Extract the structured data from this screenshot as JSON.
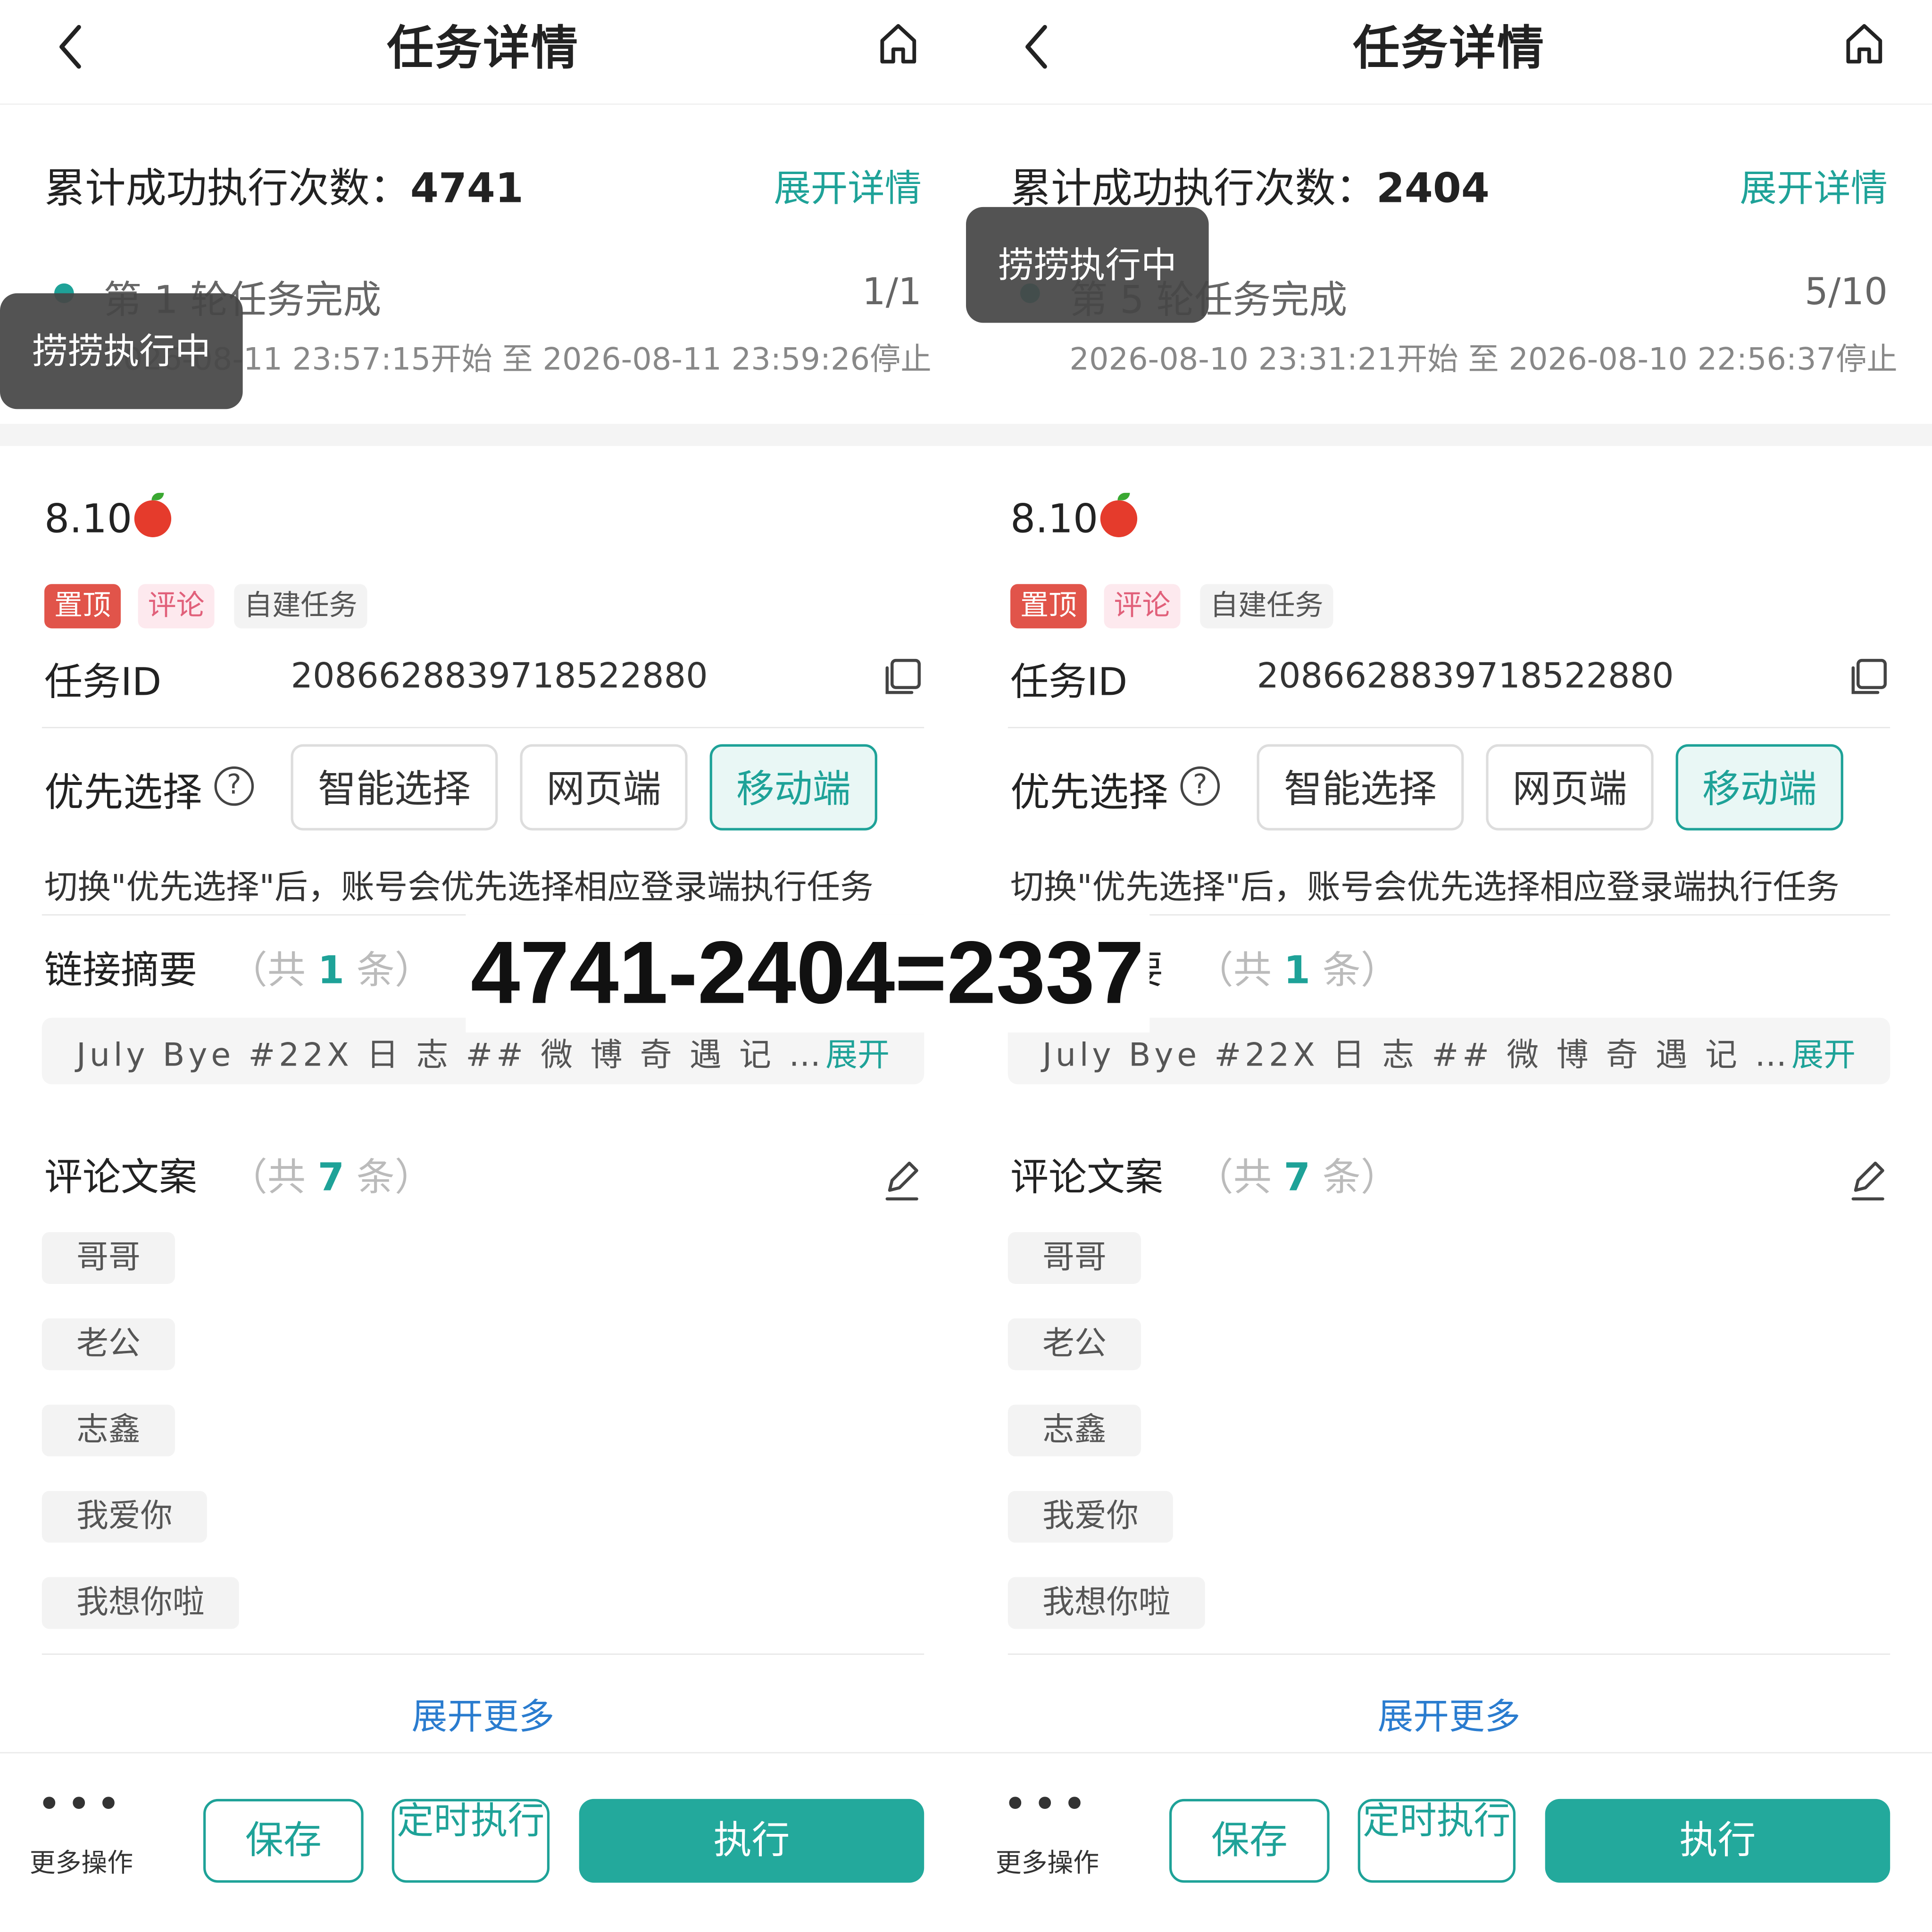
{
  "header": {
    "title": "任务详情"
  },
  "panels": [
    {
      "count_label": "累计成功执行次数：",
      "count_value": "4741",
      "expand_detail": "展开详情",
      "round_text": "第 1 轮任务完成",
      "progress": "1/1",
      "times": "2026-08-11 23:57:15开始 至 2026-08-11 23:59:26停止",
      "toast": "捞捞执行中"
    },
    {
      "count_label": "累计成功执行次数：",
      "count_value": "2404",
      "expand_detail": "展开详情",
      "round_text": "第 5 轮任务完成",
      "progress": "5/10",
      "times": "2026-08-10 23:31:21开始 至 2026-08-10 22:56:37停止",
      "toast": "捞捞执行中"
    }
  ],
  "task": {
    "name": "8.10",
    "name_icon": "apple-emoji",
    "tags": {
      "top": "置顶",
      "comment": "评论",
      "self": "自建任务"
    },
    "id_label": "任务ID",
    "id_value": "2086628839718522880",
    "priority_label": "优先选择",
    "options": [
      "智能选择",
      "网页端",
      "移动端"
    ],
    "selected_option": "移动端",
    "hint": "切换\"优先选择\"后，账号会优先选择相应登录端执行任务",
    "link_summary": {
      "label": "链接摘要",
      "count_pre": "（共",
      "count": "1",
      "count_post": "条）",
      "text": "July Bye #22X 日 志 ## 微 博 奇 遇 记 …",
      "expand": "展开"
    },
    "comments": {
      "label": "评论文案",
      "count_pre": "（共",
      "count": "7",
      "count_post": "条）",
      "items": [
        "哥哥",
        "老公",
        "志鑫",
        "我爱你",
        "我想你啦"
      ],
      "more": "展开更多"
    }
  },
  "footer": {
    "more_ops": "更多操作",
    "save": "保存",
    "timer": "定时执行",
    "execute": "执行"
  },
  "overlay_formula": "4741-2404=2337",
  "colors": {
    "accent": "#1ea298",
    "pin_tag": "#e1544a",
    "link_blue": "#2a7ccf"
  }
}
